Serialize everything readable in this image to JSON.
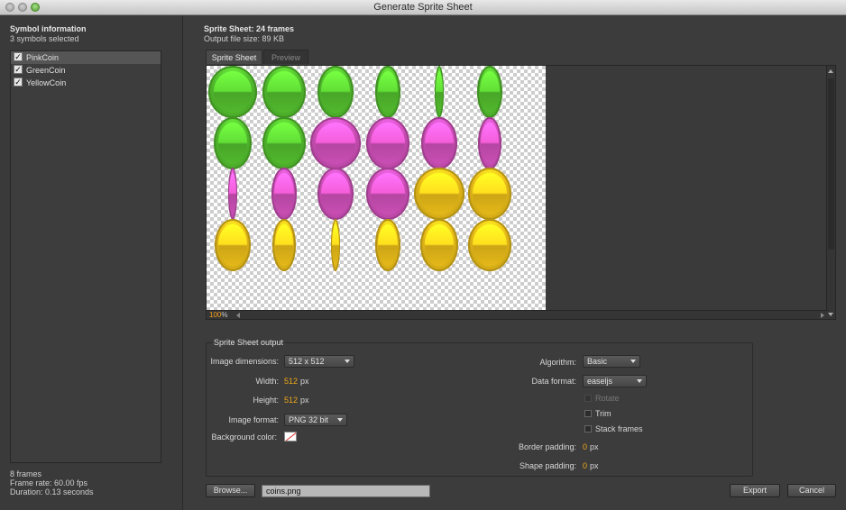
{
  "window": {
    "title": "Generate Sprite Sheet"
  },
  "symbols": {
    "header": "Symbol information",
    "selected_count": "3 symbols selected",
    "items": [
      {
        "label": "PinkCoin",
        "checked": true
      },
      {
        "label": "GreenCoin",
        "checked": true
      },
      {
        "label": "YellowCoin",
        "checked": true
      }
    ],
    "frames": "8 frames",
    "frame_rate": "Frame rate: 60.00 fps",
    "duration": "Duration: 0.13 seconds"
  },
  "sheet": {
    "title": "Sprite Sheet: 24 frames",
    "file_size": "Output file size: 89 KB",
    "tabs": [
      "Sprite Sheet",
      "Preview"
    ],
    "zoom_value": "100",
    "zoom_unit": "%"
  },
  "coin_colors": {
    "green": "#55c22f",
    "pink": "#d452bd",
    "yellow": "#f0c21a"
  },
  "output": {
    "group_title": "Sprite Sheet output",
    "image_dimensions_label": "Image dimensions:",
    "image_dimensions_value": "512 x 512",
    "width_label": "Width:",
    "width_value": "512",
    "height_label": "Height:",
    "height_value": "512",
    "px": "px",
    "image_format_label": "Image format:",
    "image_format_value": "PNG 32 bit",
    "background_color_label": "Background color:",
    "algorithm_label": "Algorithm:",
    "algorithm_value": "Basic",
    "data_format_label": "Data format:",
    "data_format_value": "easeljs",
    "rotate_label": "Rotate",
    "trim_label": "Trim",
    "stack_frames_label": "Stack frames",
    "border_padding_label": "Border padding:",
    "border_padding_value": "0",
    "shape_padding_label": "Shape padding:",
    "shape_padding_value": "0"
  },
  "footer": {
    "browse": "Browse...",
    "filename": "coins.png",
    "export": "Export",
    "cancel": "Cancel"
  }
}
